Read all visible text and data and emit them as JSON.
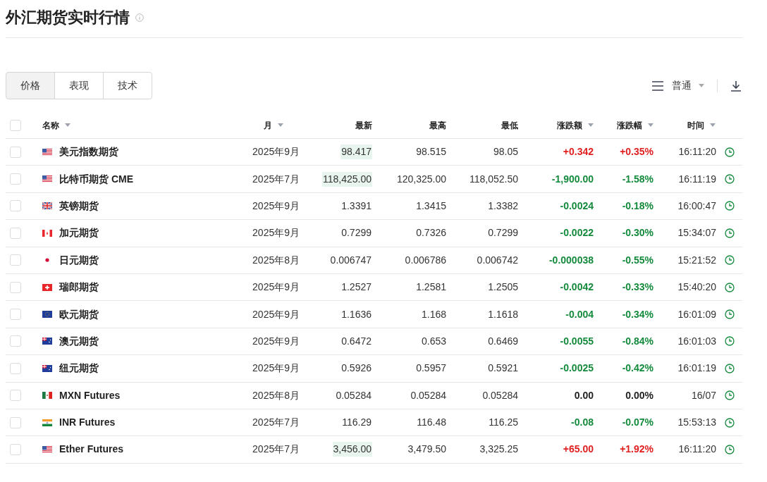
{
  "title": "外汇期货实时行情",
  "tabs": [
    {
      "label": "价格",
      "selected": true
    },
    {
      "label": "表现",
      "selected": false
    },
    {
      "label": "技术",
      "selected": false
    }
  ],
  "view_select": {
    "value": "普通"
  },
  "table": {
    "select_all": {
      "checked": false
    },
    "columns": [
      {
        "label": "名称",
        "sortable": true
      },
      {
        "label": "月",
        "sortable": true
      },
      {
        "label": "最新",
        "sortable": false
      },
      {
        "label": "最高",
        "sortable": false
      },
      {
        "label": "最低",
        "sortable": false
      },
      {
        "label": "涨跌额",
        "sortable": true
      },
      {
        "label": "涨跌幅",
        "sortable": true
      },
      {
        "label": "时间",
        "sortable": true
      }
    ],
    "rows": [
      {
        "flag": {
          "kind": "us"
        },
        "name": "美元指数期货",
        "month": "2025年9月",
        "last": "98.417",
        "last_flash": true,
        "high": "98.515",
        "low": "98.05",
        "change": {
          "text": "+0.342",
          "color": "#e02020"
        },
        "change_pct": {
          "text": "+0.35%",
          "color": "#e02020"
        },
        "time": "16:11:20",
        "checked": false
      },
      {
        "flag": {
          "kind": "us"
        },
        "name": "比特币期货 CME",
        "month": "2025年7月",
        "last": "118,425.00",
        "last_flash": true,
        "high": "120,325.00",
        "low": "118,052.50",
        "change": {
          "text": "-1,900.00",
          "color": "#148a3c"
        },
        "change_pct": {
          "text": "-1.58%",
          "color": "#148a3c"
        },
        "time": "16:11:19",
        "checked": false
      },
      {
        "flag": {
          "kind": "gb"
        },
        "name": "英镑期货",
        "month": "2025年9月",
        "last": "1.3391",
        "last_flash": false,
        "high": "1.3415",
        "low": "1.3382",
        "change": {
          "text": "-0.0024",
          "color": "#148a3c"
        },
        "change_pct": {
          "text": "-0.18%",
          "color": "#148a3c"
        },
        "time": "16:00:47",
        "checked": false
      },
      {
        "flag": {
          "kind": "ca"
        },
        "name": "加元期货",
        "month": "2025年9月",
        "last": "0.7299",
        "last_flash": false,
        "high": "0.7326",
        "low": "0.7299",
        "change": {
          "text": "-0.0022",
          "color": "#148a3c"
        },
        "change_pct": {
          "text": "-0.30%",
          "color": "#148a3c"
        },
        "time": "15:34:07",
        "checked": false
      },
      {
        "flag": {
          "kind": "jp"
        },
        "name": "日元期货",
        "month": "2025年8月",
        "last": "0.006747",
        "last_flash": false,
        "high": "0.006786",
        "low": "0.006742",
        "change": {
          "text": "-0.000038",
          "color": "#148a3c"
        },
        "change_pct": {
          "text": "-0.55%",
          "color": "#148a3c"
        },
        "time": "15:21:52",
        "checked": false
      },
      {
        "flag": {
          "kind": "ch"
        },
        "name": "瑞郎期货",
        "month": "2025年9月",
        "last": "1.2527",
        "last_flash": false,
        "high": "1.2581",
        "low": "1.2505",
        "change": {
          "text": "-0.0042",
          "color": "#148a3c"
        },
        "change_pct": {
          "text": "-0.33%",
          "color": "#148a3c"
        },
        "time": "15:40:20",
        "checked": false
      },
      {
        "flag": {
          "kind": "eu"
        },
        "name": "欧元期货",
        "month": "2025年9月",
        "last": "1.1636",
        "last_flash": false,
        "high": "1.168",
        "low": "1.1618",
        "change": {
          "text": "-0.004",
          "color": "#148a3c"
        },
        "change_pct": {
          "text": "-0.34%",
          "color": "#148a3c"
        },
        "time": "16:01:09",
        "checked": false
      },
      {
        "flag": {
          "kind": "au"
        },
        "name": "澳元期货",
        "month": "2025年9月",
        "last": "0.6472",
        "last_flash": false,
        "high": "0.653",
        "low": "0.6469",
        "change": {
          "text": "-0.0055",
          "color": "#148a3c"
        },
        "change_pct": {
          "text": "-0.84%",
          "color": "#148a3c"
        },
        "time": "16:01:03",
        "checked": false
      },
      {
        "flag": {
          "kind": "nz"
        },
        "name": "纽元期货",
        "month": "2025年9月",
        "last": "0.5926",
        "last_flash": false,
        "high": "0.5957",
        "low": "0.5921",
        "change": {
          "text": "-0.0025",
          "color": "#148a3c"
        },
        "change_pct": {
          "text": "-0.42%",
          "color": "#148a3c"
        },
        "time": "16:01:19",
        "checked": false
      },
      {
        "flag": {
          "kind": "mx"
        },
        "name": "MXN Futures",
        "month": "2025年8月",
        "last": "0.05284",
        "last_flash": false,
        "high": "0.05284",
        "low": "0.05284",
        "change": {
          "text": "0.00",
          "color": "#222222"
        },
        "change_pct": {
          "text": "0.00%",
          "color": "#222222"
        },
        "time": "16/07",
        "checked": false
      },
      {
        "flag": {
          "kind": "in"
        },
        "name": "INR Futures",
        "month": "2025年7月",
        "last": "116.29",
        "last_flash": false,
        "high": "116.48",
        "low": "116.25",
        "change": {
          "text": "-0.08",
          "color": "#148a3c"
        },
        "change_pct": {
          "text": "-0.07%",
          "color": "#148a3c"
        },
        "time": "15:53:13",
        "checked": false
      },
      {
        "flag": {
          "kind": "us"
        },
        "name": "Ether Futures",
        "month": "2025年7月",
        "last": "3,456.00",
        "last_flash": true,
        "high": "3,479.50",
        "low": "3,325.25",
        "change": {
          "text": "+65.00",
          "color": "#e02020"
        },
        "change_pct": {
          "text": "+1.92%",
          "color": "#e02020"
        },
        "time": "16:11:20",
        "checked": false
      }
    ]
  }
}
